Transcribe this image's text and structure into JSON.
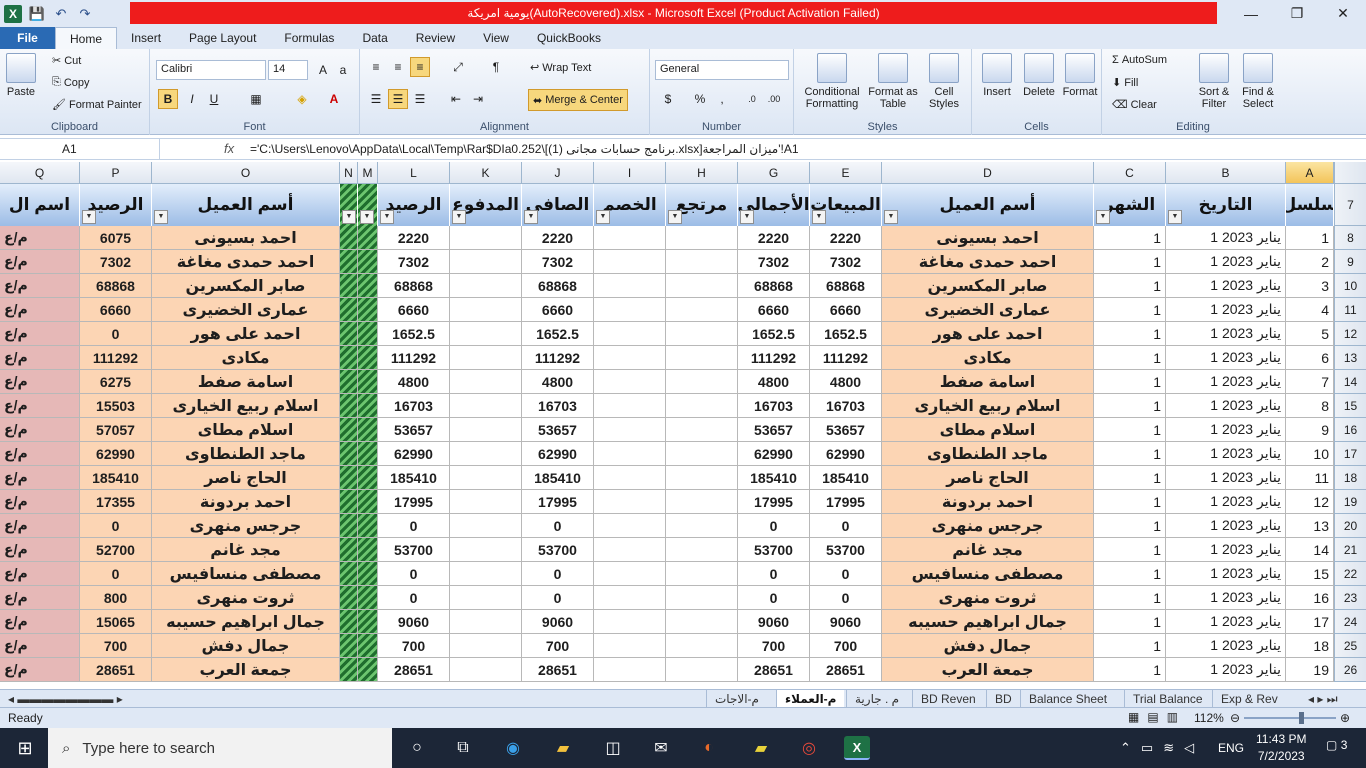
{
  "window": {
    "title": "يومية امريكة(AutoRecovered).xlsx  -  Microsoft Excel (Product Activation Failed)",
    "controls": [
      "—",
      "❐",
      "✕"
    ]
  },
  "qat": {
    "logo": "X",
    "save_icon": "💾",
    "undo": "↶",
    "redo": "↷"
  },
  "ribbon_tabs": [
    "File",
    "Home",
    "Insert",
    "Page Layout",
    "Formulas",
    "Data",
    "Review",
    "View",
    "QuickBooks"
  ],
  "ribbon": {
    "clipboard": {
      "paste": "Paste",
      "cut": "Cut",
      "copy": "Copy",
      "format_painter": "Format Painter",
      "label": "Clipboard"
    },
    "font": {
      "name": "Calibri",
      "size": "14",
      "bold": "B",
      "italic": "I",
      "underline": "U",
      "label": "Font"
    },
    "alignment": {
      "wrap": "Wrap Text",
      "merge": "Merge & Center",
      "label": "Alignment"
    },
    "number": {
      "format": "General",
      "currency": "$",
      "percent": "%",
      "comma": ",",
      "label": "Number"
    },
    "styles": {
      "conditional": "Conditional Formatting",
      "table": "Format as Table",
      "cell": "Cell Styles",
      "label": "Styles"
    },
    "cells": {
      "insert": "Insert",
      "delete": "Delete",
      "format": "Format",
      "label": "Cells"
    },
    "editing": {
      "autosum": "AutoSum",
      "fill": "Fill",
      "clear": "Clear",
      "sort": "Sort & Filter",
      "find": "Find & Select",
      "label": "Editing"
    }
  },
  "formula_bar": {
    "name_box": "A1",
    "fx": "fx",
    "formula": "='C:\\Users\\Lenovo\\AppData\\Local\\Temp\\Rar$DIa0.252\\[برنامج حسابات مجانى (1).xlsx]ميزان المراجعة'!A1"
  },
  "column_letters": [
    "A",
    "B",
    "C",
    "D",
    "E",
    "G",
    "H",
    "I",
    "J",
    "K",
    "L",
    "M",
    "N",
    "O",
    "P",
    "Q"
  ],
  "headers": {
    "A": "سلسل",
    "B": "التاريخ",
    "C": "الشهر",
    "D": "أسم العميل",
    "E": "المبيعات",
    "G": "الأجمالي",
    "H": "مرتجع",
    "I": "الخصم",
    "J": "الصافي",
    "K": "المدفوع",
    "L": "الرصيد",
    "O": "أسم العميل",
    "P": "الرصيد",
    "Q": "اسم ال"
  },
  "header_row_number": "7",
  "rows": [
    {
      "r": "8",
      "a": "1",
      "b": "1 يناير 2023",
      "c": "1",
      "d": "احمد بسيونى",
      "e": "2220",
      "g": "2220",
      "j": "2220",
      "l": "2220",
      "o": "احمد بسيونى",
      "p": "6075",
      "q": "م/ع"
    },
    {
      "r": "9",
      "a": "2",
      "b": "1 يناير 2023",
      "c": "1",
      "d": "احمد حمدى مغاغة",
      "e": "7302",
      "g": "7302",
      "j": "7302",
      "l": "7302",
      "o": "احمد حمدى مغاغة",
      "p": "7302",
      "q": "م/ع"
    },
    {
      "r": "10",
      "a": "3",
      "b": "1 يناير 2023",
      "c": "1",
      "d": "صابر المكسرين",
      "e": "68868",
      "g": "68868",
      "j": "68868",
      "l": "68868",
      "o": "صابر المكسرين",
      "p": "68868",
      "q": "م/ع"
    },
    {
      "r": "11",
      "a": "4",
      "b": "1 يناير 2023",
      "c": "1",
      "d": "عمارى الخضيرى",
      "e": "6660",
      "g": "6660",
      "j": "6660",
      "l": "6660",
      "o": "عمارى الخضيرى",
      "p": "6660",
      "q": "م/ع"
    },
    {
      "r": "12",
      "a": "5",
      "b": "1 يناير 2023",
      "c": "1",
      "d": "احمد على هور",
      "e": "1652.5",
      "g": "1652.5",
      "j": "1652.5",
      "l": "1652.5",
      "o": "احمد على هور",
      "p": "0",
      "q": "م/ع"
    },
    {
      "r": "13",
      "a": "6",
      "b": "1 يناير 2023",
      "c": "1",
      "d": "مكادى",
      "e": "111292",
      "g": "111292",
      "j": "111292",
      "l": "111292",
      "o": "مكادى",
      "p": "111292",
      "q": "م/ع"
    },
    {
      "r": "14",
      "a": "7",
      "b": "1 يناير 2023",
      "c": "1",
      "d": "اسامة صفط",
      "e": "4800",
      "g": "4800",
      "j": "4800",
      "l": "4800",
      "o": "اسامة صفط",
      "p": "6275",
      "q": "م/ع"
    },
    {
      "r": "15",
      "a": "8",
      "b": "1 يناير 2023",
      "c": "1",
      "d": "اسلام ربيع الخيارى",
      "e": "16703",
      "g": "16703",
      "j": "16703",
      "l": "16703",
      "o": "اسلام ربيع الخيارى",
      "p": "15503",
      "q": "م/ع"
    },
    {
      "r": "16",
      "a": "9",
      "b": "1 يناير 2023",
      "c": "1",
      "d": "اسلام مطاى",
      "e": "53657",
      "g": "53657",
      "j": "53657",
      "l": "53657",
      "o": "اسلام مطاى",
      "p": "57057",
      "q": "م/ع"
    },
    {
      "r": "17",
      "a": "10",
      "b": "1 يناير 2023",
      "c": "1",
      "d": "ماجد الطنطاوى",
      "e": "62990",
      "g": "62990",
      "j": "62990",
      "l": "62990",
      "o": "ماجد الطنطاوى",
      "p": "62990",
      "q": "م/ع"
    },
    {
      "r": "18",
      "a": "11",
      "b": "1 يناير 2023",
      "c": "1",
      "d": "الحاج ناصر",
      "e": "185410",
      "g": "185410",
      "j": "185410",
      "l": "185410",
      "o": "الحاج ناصر",
      "p": "185410",
      "q": "م/ع"
    },
    {
      "r": "19",
      "a": "12",
      "b": "1 يناير 2023",
      "c": "1",
      "d": "احمد بردونة",
      "e": "17995",
      "g": "17995",
      "j": "17995",
      "l": "17995",
      "o": "احمد بردونة",
      "p": "17355",
      "q": "م/ع"
    },
    {
      "r": "20",
      "a": "13",
      "b": "1 يناير 2023",
      "c": "1",
      "d": "جرجس منهرى",
      "e": "0",
      "g": "0",
      "j": "0",
      "l": "0",
      "o": "جرجس منهرى",
      "p": "0",
      "q": "م/ع"
    },
    {
      "r": "21",
      "a": "14",
      "b": "1 يناير 2023",
      "c": "1",
      "d": "مجد غانم",
      "e": "53700",
      "g": "53700",
      "j": "53700",
      "l": "53700",
      "o": "مجد غانم",
      "p": "52700",
      "q": "م/ع"
    },
    {
      "r": "22",
      "a": "15",
      "b": "1 يناير 2023",
      "c": "1",
      "d": "مصطفى منسافيس",
      "e": "0",
      "g": "0",
      "j": "0",
      "l": "0",
      "o": "مصطفى منسافيس",
      "p": "0",
      "q": "م/ع"
    },
    {
      "r": "23",
      "a": "16",
      "b": "1 يناير 2023",
      "c": "1",
      "d": "ثروت منهرى",
      "e": "0",
      "g": "0",
      "j": "0",
      "l": "0",
      "o": "ثروت منهرى",
      "p": "800",
      "q": "م/ع"
    },
    {
      "r": "24",
      "a": "17",
      "b": "1 يناير 2023",
      "c": "1",
      "d": "جمال ابراهيم حسيبه",
      "e": "9060",
      "g": "9060",
      "j": "9060",
      "l": "9060",
      "o": "جمال ابراهيم حسيبه",
      "p": "15065",
      "q": "م/ع"
    },
    {
      "r": "25",
      "a": "18",
      "b": "1 يناير 2023",
      "c": "1",
      "d": "جمال دفش",
      "e": "700",
      "g": "700",
      "j": "700",
      "l": "700",
      "o": "جمال دفش",
      "p": "700",
      "q": "م/ع"
    },
    {
      "r": "26",
      "a": "19",
      "b": "1 يناير 2023",
      "c": "1",
      "d": "جمعة العرب",
      "e": "28651",
      "g": "28651",
      "j": "28651",
      "l": "28651",
      "o": "جمعة العرب",
      "p": "28651",
      "q": "م/ع"
    }
  ],
  "sheet_tabs": [
    "Exp & Rev",
    "Trial Balance",
    "Balance Sheet",
    "BD",
    "BD Reven",
    "م . جارية",
    "م-العملاء",
    "م-الاجات"
  ],
  "active_sheet": "م-العملاء",
  "status": {
    "ready": "Ready",
    "zoom": "112%"
  },
  "taskbar": {
    "search": "Type here to search",
    "time": "11:43 PM",
    "date": "7/2/2023",
    "lang": "ENG",
    "notifications": "3"
  },
  "colors": {
    "peach": "#fcd5b4",
    "pink": "#e6b8b7",
    "header_blue": "#9cbce6",
    "title_red": "#ee1c1c",
    "excel_green": "#1e7145"
  }
}
